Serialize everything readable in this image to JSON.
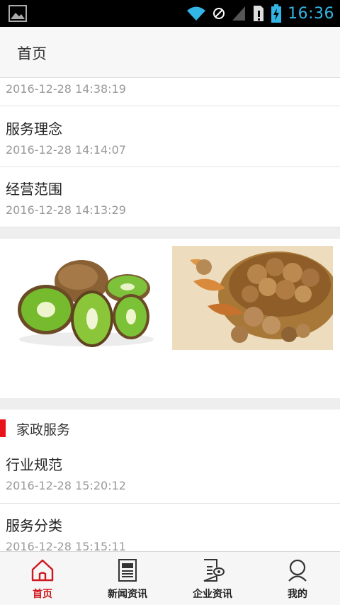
{
  "status_bar": {
    "time": "16:36",
    "icons": [
      "image-icon",
      "wifi-icon",
      "no-sim-icon",
      "signal-icon",
      "sd-alert-icon",
      "battery-charging-icon"
    ]
  },
  "header": {
    "title": "首页"
  },
  "news_list": [
    {
      "title": "",
      "date": "2016-12-28 14:38:19"
    },
    {
      "title": "服务理念",
      "date": "2016-12-28 14:14:07"
    },
    {
      "title": "经营范围",
      "date": "2016-12-28 14:13:29"
    }
  ],
  "images": [
    "kiwi-fruit-image",
    "walnuts-basket-image"
  ],
  "section": {
    "title": "家政服务"
  },
  "service_list": [
    {
      "title": "行业规范",
      "date": "2016-12-28 15:20:12"
    },
    {
      "title": "服务分类",
      "date": "2016-12-28 15:15:11"
    }
  ],
  "bottom_nav": [
    {
      "label": "首页",
      "icon": "home-icon",
      "active": true
    },
    {
      "label": "新闻资讯",
      "icon": "newspaper-icon",
      "active": false
    },
    {
      "label": "企业资讯",
      "icon": "document-eye-icon",
      "active": false
    },
    {
      "label": "我的",
      "icon": "person-icon",
      "active": false
    }
  ],
  "colors": {
    "accent": "#d0161e",
    "status_icon": "#33b5e5",
    "date_text": "#999999"
  }
}
